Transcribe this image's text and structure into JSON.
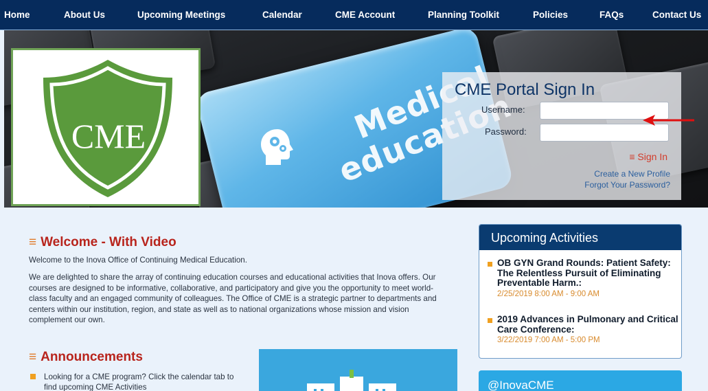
{
  "nav": {
    "items": [
      "Home",
      "About Us",
      "Upcoming Meetings",
      "Calendar",
      "CME Account",
      "Planning Toolkit",
      "Policies",
      "FAQs",
      "Contact Us"
    ]
  },
  "hero": {
    "logo_text": "CME",
    "key_text_1": "Medical",
    "key_text_2": "education"
  },
  "login": {
    "title": "CME Portal Sign In",
    "username_label": "Username:",
    "password_label": "Password:",
    "username_value": "",
    "password_value": "",
    "signin_label": "≡ Sign In",
    "create_profile": "Create a New Profile",
    "forgot_password": "Forgot Your Password?"
  },
  "welcome": {
    "title": "Welcome - With Video",
    "intro": "Welcome to the Inova Office of Continuing Medical Education.",
    "body": "We are delighted to share the array of continuing education courses and educational activities that Inova offers. Our courses are designed to be informative, collaborative, and participatory and give you the opportunity to meet world-class faculty and an engaged community of colleagues. The Office of CME is a strategic partner to departments and centers within our institution, region, and state as well as to national organizations whose mission and vision complement our own."
  },
  "announcements": {
    "title": "Announcements",
    "items": [
      "Looking for a CME program? Click the calendar tab to find upcoming CME Activities"
    ]
  },
  "upcoming": {
    "title": "Upcoming Activities",
    "items": [
      {
        "title": "OB GYN Grand Rounds: Patient Safety: The Relentless Pursuit of Eliminating Preventable Harm.:",
        "date": "2/25/2019 8:00 AM - 9:00 AM"
      },
      {
        "title": "2019 Advances in Pulmonary and Critical Care Conference:",
        "date": "3/22/2019 7:00 AM - 5:00 PM"
      }
    ]
  },
  "twitter": {
    "handle": "@InovaCME"
  },
  "colors": {
    "nav_bg": "#062b5c",
    "accent_red": "#b8241c",
    "accent_orange": "#f0a020",
    "panel_blue": "#0a3b70",
    "twitter_blue": "#2ba8e4",
    "arrow_red": "#e01010"
  }
}
